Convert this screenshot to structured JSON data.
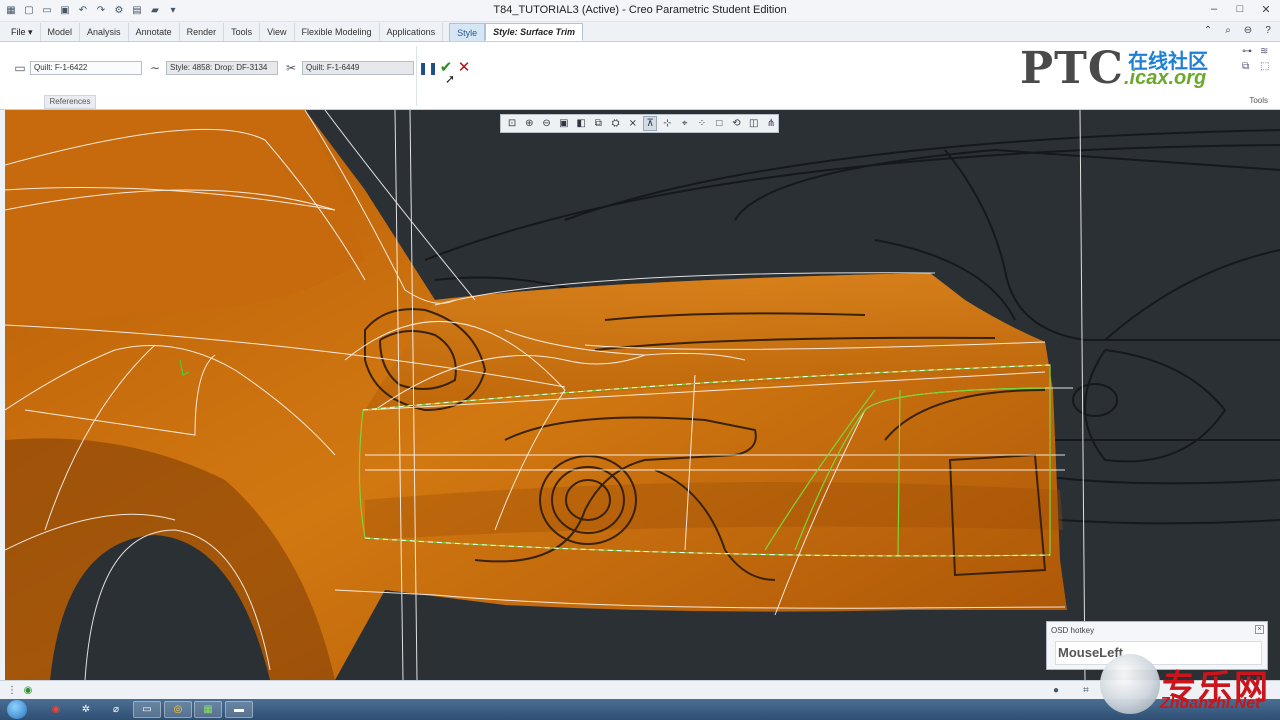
{
  "window": {
    "title": "T84_TUTORIAL3 (Active) - Creo Parametric Student Edition"
  },
  "tabs": [
    {
      "label": "File ▾"
    },
    {
      "label": "Model"
    },
    {
      "label": "Analysis"
    },
    {
      "label": "Annotate"
    },
    {
      "label": "Render"
    },
    {
      "label": "Tools"
    },
    {
      "label": "View"
    },
    {
      "label": "Flexible Modeling"
    },
    {
      "label": "Applications"
    },
    {
      "label": "Style"
    },
    {
      "label": "Style: Surface Trim"
    }
  ],
  "ribbon": {
    "quilt_field": "Quilt: F-1-6422",
    "curve_field": "Style: 4858: Drop:   DF-3134",
    "trim_field": "Quilt: F-1-6449",
    "references_label": "References",
    "tools_label": "Tools"
  },
  "logos": {
    "ptc": "PTC",
    "community_cn": "在线社区",
    "community_site": ".icax.org"
  },
  "osd": {
    "title": "OSD hotkey",
    "key": "MouseLeft"
  },
  "watermark": {
    "cn": "专乐网",
    "url": "Zhuanzhi.Net"
  },
  "colors": {
    "surface": "#c86b0c",
    "viewport_bg": "#2b3034",
    "accent": "#1d7fd6"
  }
}
